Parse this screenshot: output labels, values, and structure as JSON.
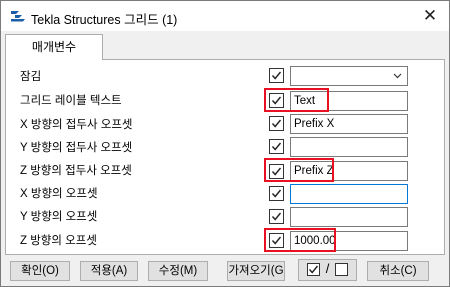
{
  "window": {
    "title": "Tekla Structures  그리드 (1)",
    "close_glyph": "✕",
    "app_icon": "tekla-logo-icon"
  },
  "tabs": [
    {
      "label": "매개변수",
      "selected": true
    }
  ],
  "rows": [
    {
      "label": "잠김",
      "checked": true,
      "value": "",
      "type": "dropdown"
    },
    {
      "label": "그리드 레이블 텍스트",
      "checked": true,
      "value": "Text",
      "type": "text"
    },
    {
      "label": "X 방향의 접두사 오프셋",
      "checked": true,
      "value": "Prefix X",
      "type": "text"
    },
    {
      "label": "Y 방향의 접두사 오프셋",
      "checked": true,
      "value": "",
      "type": "text"
    },
    {
      "label": "Z 방향의 접두사 오프셋",
      "checked": true,
      "value": "Prefix Z",
      "type": "text"
    },
    {
      "label": "X 방향의 오프셋",
      "checked": true,
      "value": "",
      "type": "text"
    },
    {
      "label": "Y 방향의 오프셋",
      "checked": true,
      "value": "",
      "type": "text"
    },
    {
      "label": "Z 방향의 오프셋",
      "checked": true,
      "value": "1000.00",
      "type": "text"
    }
  ],
  "buttons": {
    "ok": "확인(O)",
    "apply": "적용(A)",
    "modify": "수정(M)",
    "get": "가져오기(G",
    "toggle_separator": "/",
    "cancel": "취소(C)"
  },
  "colors": {
    "highlight": "#e81123",
    "focus": "#0078d7",
    "button_bg": "#e1e1e1"
  }
}
